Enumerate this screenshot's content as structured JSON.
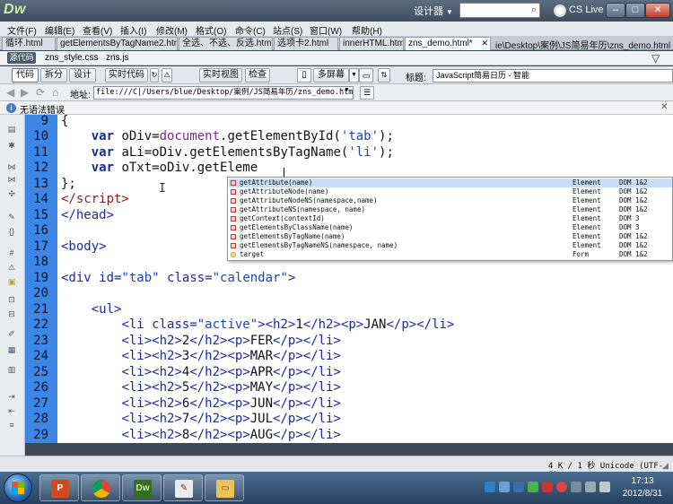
{
  "titlebar": {
    "app_logo": "Dw",
    "designer": "设计器",
    "cs_live": "CS Live",
    "min": "–",
    "max": "□",
    "close": "✕"
  },
  "menus": [
    "文件(F)",
    "编辑(E)",
    "查看(V)",
    "插入(I)",
    "修改(M)",
    "格式(O)",
    "命令(C)",
    "站点(S)",
    "窗口(W)",
    "帮助(H)"
  ],
  "tabs": [
    "循环.html",
    "getElementsByTagName2.html",
    "全选、不选、反选.html",
    "选项卡2.html",
    "innerHTML.html",
    "zns_demo.html*"
  ],
  "file_path": "ie\\Desktop\\案例\\JS简易年历\\zns_demo.html",
  "related": {
    "source": "源代码",
    "files": [
      "zns_style.css",
      "zns.js"
    ]
  },
  "doc_toolbar": {
    "code": "代码",
    "split": "拆分",
    "design": "设计",
    "live_code": "实时代码",
    "live_view": "实时视图",
    "inspect": "检查",
    "multiscreen": "多屏幕",
    "title_label": "标题:",
    "title_value": "JavaScript简易日历 - 智能"
  },
  "address": {
    "label": "地址:",
    "value": "file:///C|/Users/blue/Desktop/案例/JS简易年历/zns_demo.html"
  },
  "syntax_status": "无语法错误",
  "code_lines": [
    {
      "n": "9",
      "html": "{"
    },
    {
      "n": "10",
      "html": "    <span class=\"kw\">var</span> oDiv=<span class=\"obj\">document</span>.getElementById(<span class=\"str\">'tab'</span>);"
    },
    {
      "n": "11",
      "html": "    <span class=\"kw\">var</span> aLi=oDiv.getElementsByTagName(<span class=\"str\">'li'</span>);"
    },
    {
      "n": "12",
      "html": "    <span class=\"kw\">var</span> oTxt=oDiv.getEleme"
    },
    {
      "n": "13",
      "html": "};"
    },
    {
      "n": "14",
      "html": "<span class=\"tagc\">&lt;/script&gt;</span>"
    },
    {
      "n": "15",
      "html": "<span class=\"tag\">&lt;/head&gt;</span>"
    },
    {
      "n": "16",
      "html": ""
    },
    {
      "n": "17",
      "html": "<span class=\"tag\">&lt;body&gt;</span>"
    },
    {
      "n": "18",
      "html": ""
    },
    {
      "n": "19",
      "html": "<span class=\"tag\">&lt;div id=</span><span class=\"str\">\"tab\"</span><span class=\"tag\"> class=</span><span class=\"str\">\"calendar\"</span><span class=\"tag\">&gt;</span>"
    },
    {
      "n": "20",
      "html": ""
    },
    {
      "n": "21",
      "html": "    <span class=\"tag\">&lt;ul&gt;</span>"
    },
    {
      "n": "22",
      "html": "        <span class=\"tag\">&lt;li class=</span><span class=\"str\">\"active\"</span><span class=\"tag\">&gt;&lt;h2&gt;</span>1<span class=\"tag\">&lt;/h2&gt;&lt;p&gt;</span>JAN<span class=\"tag\">&lt;/p&gt;&lt;/li&gt;</span>"
    },
    {
      "n": "23",
      "html": "        <span class=\"tag\">&lt;li&gt;&lt;h2&gt;</span>2<span class=\"tag\">&lt;/h2&gt;&lt;p&gt;</span>FER<span class=\"tag\">&lt;/p&gt;&lt;/li&gt;</span>"
    },
    {
      "n": "24",
      "html": "        <span class=\"tag\">&lt;li&gt;&lt;h2&gt;</span>3<span class=\"tag\">&lt;/h2&gt;&lt;p&gt;</span>MAR<span class=\"tag\">&lt;/p&gt;&lt;/li&gt;</span>"
    },
    {
      "n": "25",
      "html": "        <span class=\"tag\">&lt;li&gt;&lt;h2&gt;</span>4<span class=\"tag\">&lt;/h2&gt;&lt;p&gt;</span>APR<span class=\"tag\">&lt;/p&gt;&lt;/li&gt;</span>"
    },
    {
      "n": "26",
      "html": "        <span class=\"tag\">&lt;li&gt;&lt;h2&gt;</span>5<span class=\"tag\">&lt;/h2&gt;&lt;p&gt;</span>MAY<span class=\"tag\">&lt;/p&gt;&lt;/li&gt;</span>"
    },
    {
      "n": "27",
      "html": "        <span class=\"tag\">&lt;li&gt;&lt;h2&gt;</span>6<span class=\"tag\">&lt;/h2&gt;&lt;p&gt;</span>JUN<span class=\"tag\">&lt;/p&gt;&lt;/li&gt;</span>"
    },
    {
      "n": "28",
      "html": "        <span class=\"tag\">&lt;li&gt;&lt;h2&gt;</span>7<span class=\"tag\">&lt;/h2&gt;&lt;p&gt;</span>JUL<span class=\"tag\">&lt;/p&gt;&lt;/li&gt;</span>"
    },
    {
      "n": "29",
      "html": "        <span class=\"tag\">&lt;li&gt;&lt;h2&gt;</span>8<span class=\"tag\">&lt;/h2&gt;&lt;p&gt;</span>AUG<span class=\"tag\">&lt;/p&gt;&lt;/li&gt;</span>"
    }
  ],
  "code_hints": [
    {
      "name": "getAttribute(name)",
      "type": "Element",
      "dom": "DOM 1&2",
      "kind": "method",
      "selected": true
    },
    {
      "name": "getAttributeNode(name)",
      "type": "Element",
      "dom": "DOM 1&2",
      "kind": "method"
    },
    {
      "name": "getAttributeNodeNS(namespace,name)",
      "type": "Element",
      "dom": "DOM 1&2",
      "kind": "method"
    },
    {
      "name": "getAttributeNS(namespace, name)",
      "type": "Element",
      "dom": "DOM 1&2",
      "kind": "method"
    },
    {
      "name": "getContext(contextId)",
      "type": "Element",
      "dom": "DOM 3",
      "kind": "method"
    },
    {
      "name": "getElementsByClassName(name)",
      "type": "Element",
      "dom": "DOM 3",
      "kind": "method"
    },
    {
      "name": "getElementsByTagName(name)",
      "type": "Element",
      "dom": "DOM 1&2",
      "kind": "method"
    },
    {
      "name": "getElementsByTagNameNS(namespace, name)",
      "type": "Element",
      "dom": "DOM 1&2",
      "kind": "method"
    },
    {
      "name": "target",
      "type": "Form",
      "dom": "DOM 1&2",
      "kind": "property"
    }
  ],
  "status_bar": "4 K / 1 秒 Unicode (UTF-8)",
  "taskbar": {
    "time": "17:13",
    "date": "2012/8/31",
    "apps": [
      "ppt-icon",
      "chrome-icon",
      "dreamweaver-icon",
      "notepad-icon",
      "explorer-icon"
    ],
    "dw_label": "Dw"
  },
  "colors": {
    "gutter": "#3d86e6",
    "selected_hint": "#c6def8",
    "title_bar": "#4b5c6e"
  }
}
